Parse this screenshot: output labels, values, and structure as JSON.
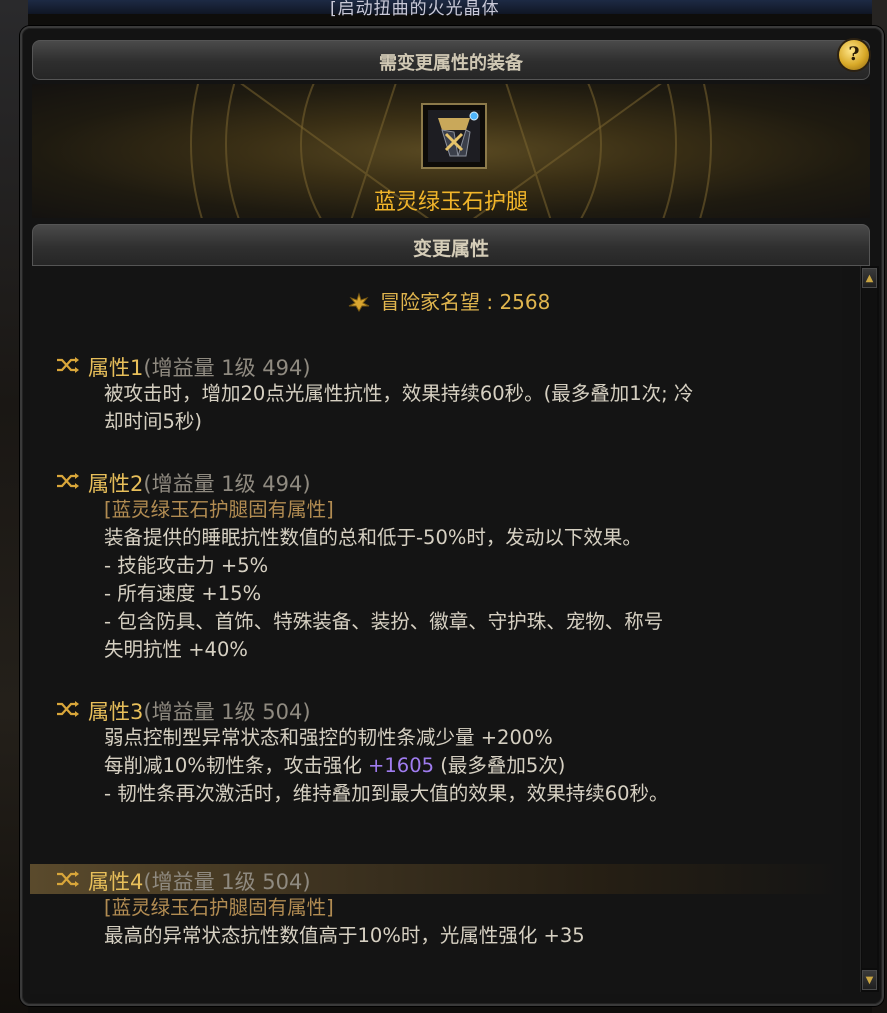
{
  "top_banner": "[启动扭曲的火光晶体",
  "header": {
    "title": "需变更属性的装备",
    "help_label": "?"
  },
  "equipment": {
    "name": "蓝灵绿玉石护腿",
    "icon": "leg-armor-icon"
  },
  "section": {
    "title": "变更属性"
  },
  "fame": {
    "icon": "fame-emblem-icon",
    "label": "冒险家名望",
    "separator": " : ",
    "value": "2568"
  },
  "attributes": [
    {
      "name": "属性1",
      "meta": "(增益量 1级 494)",
      "lines": [
        "被攻击时，增加20点光属性抗性，效果持续60秒。(最多叠加1次; 冷",
        "却时间5秒)"
      ]
    },
    {
      "name": "属性2",
      "meta": "(增益量 1级 494)",
      "tag": "[蓝灵绿玉石护腿固有属性]",
      "lines": [
        "装备提供的睡眠抗性数值的总和低于-50%时，发动以下效果。",
        "- 技能攻击力 +5%",
        "- 所有速度 +15%",
        "- 包含防具、首饰、特殊装备、装扮、徽章、守护珠、宠物、称号",
        "失明抗性 +40%"
      ]
    },
    {
      "name": "属性3",
      "meta": "(增益量 1级 504)",
      "lines": [
        "弱点控制型异常状态和强控的韧性条减少量 +200%"
      ],
      "line2_pre": "每削减10%韧性条，攻击强化 ",
      "line2_highlight": "+1605",
      "line2_post": " (最多叠加5次)",
      "line3": "- 韧性条再次激活时，维持叠加到最大值的效果，效果持续60秒。"
    },
    {
      "name": "属性4",
      "meta": "(增益量 1级 504)",
      "tag": "[蓝灵绿玉石护腿固有属性]",
      "lines": [
        "最高的异常状态抗性数值高于10%时，光属性强化 +35"
      ]
    }
  ],
  "scrollbar": {
    "up": "▲",
    "down": "▼"
  },
  "colors": {
    "gold_text": "#e8bf5a",
    "equip_name": "#f1b52a",
    "purple_value": "#a07cf0"
  }
}
